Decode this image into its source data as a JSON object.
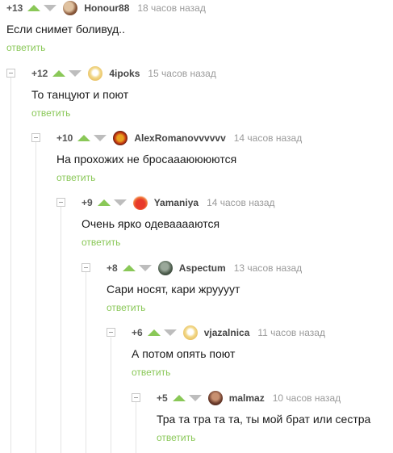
{
  "colors": {
    "upvote": "#8ac858",
    "downvote": "#bdbdbd",
    "reply": "#8ac858"
  },
  "comments": [
    {
      "rating": "+13",
      "author": "Honour88",
      "time": "18 часов назад",
      "text": "Если снимет боливуд..",
      "reply": "ответить"
    },
    {
      "rating": "+12",
      "author": "4ipoks",
      "time": "15 часов назад",
      "text": "То танцуют и поют",
      "reply": "ответить"
    },
    {
      "rating": "+10",
      "author": "AlexRomanovvvvvv",
      "time": "14 часов назад",
      "text": "На прохожих не бросаааюююются",
      "reply": "ответить"
    },
    {
      "rating": "+9",
      "author": "Yamaniya",
      "time": "14 часов назад",
      "text": "Очень ярко одевааааются",
      "reply": "ответить"
    },
    {
      "rating": "+8",
      "author": "Aspectum",
      "time": "13 часов назад",
      "text": "Сари носят, кари жруууут",
      "reply": "ответить"
    },
    {
      "rating": "+6",
      "author": "vjazalnica",
      "time": "11 часов назад",
      "text": "А потом опять поют",
      "reply": "ответить"
    },
    {
      "rating": "+5",
      "author": "malmaz",
      "time": "10 часов назад",
      "text": "Тра та тра та та, ты мой брат или сестра",
      "reply": "ответить"
    }
  ]
}
